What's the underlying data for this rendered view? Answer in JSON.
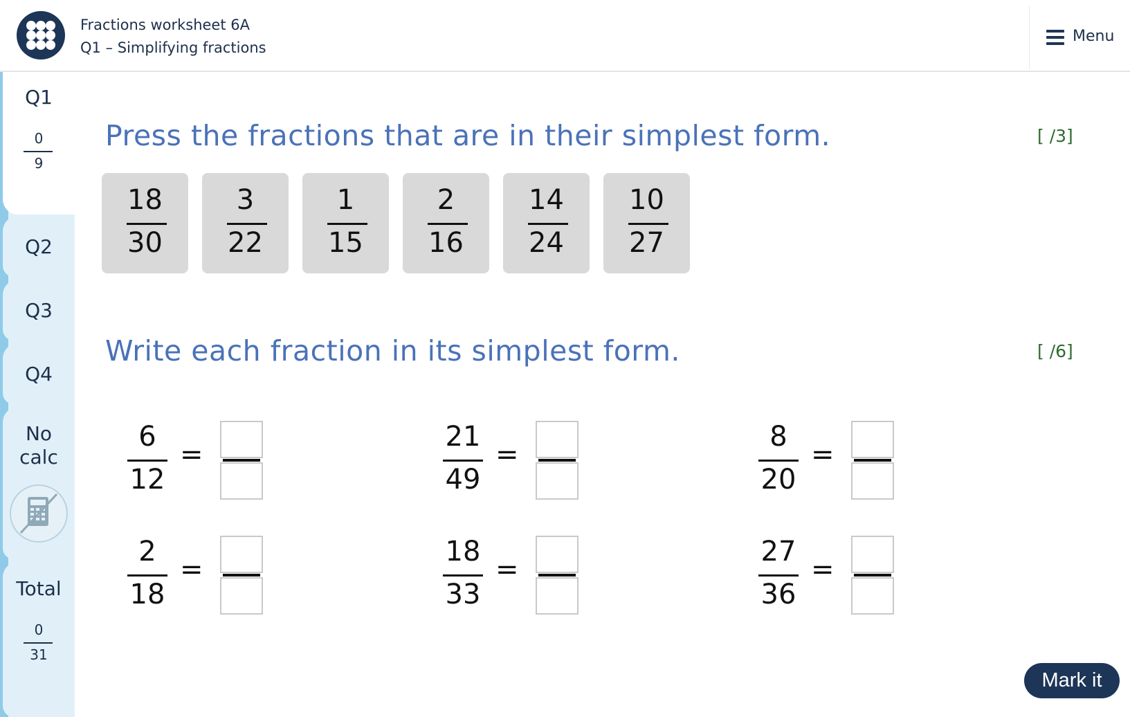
{
  "header": {
    "title": "Fractions worksheet 6A",
    "subtitle": "Q1 – Simplifying fractions",
    "logo_icon": "dots-grid-icon",
    "menu_label": "Menu"
  },
  "sidebar": {
    "q1": {
      "label": "Q1",
      "score": "0",
      "max": "9"
    },
    "q2": {
      "label": "Q2"
    },
    "q3": {
      "label": "Q3"
    },
    "q4": {
      "label": "Q4"
    },
    "nocalc": {
      "line1": "No",
      "line2": "calc",
      "icon": "no-calculator-icon"
    },
    "total": {
      "label": "Total",
      "score": "0",
      "max": "31"
    }
  },
  "part1": {
    "instruction": "Press the fractions that are in their simplest form.",
    "marks": "[ /3]",
    "cards": [
      {
        "num": "18",
        "den": "30"
      },
      {
        "num": "3",
        "den": "22"
      },
      {
        "num": "1",
        "den": "15"
      },
      {
        "num": "2",
        "den": "16"
      },
      {
        "num": "14",
        "den": "24"
      },
      {
        "num": "10",
        "den": "27"
      }
    ]
  },
  "part2": {
    "instruction": "Write each fraction in its simplest form.",
    "marks": "[ /6]",
    "equals": "=",
    "questions": [
      {
        "num": "6",
        "den": "12"
      },
      {
        "num": "21",
        "den": "49"
      },
      {
        "num": "8",
        "den": "20"
      },
      {
        "num": "2",
        "den": "18"
      },
      {
        "num": "18",
        "den": "33"
      },
      {
        "num": "27",
        "den": "36"
      }
    ]
  },
  "mark_button": "Mark it",
  "colors": {
    "navy": "#1d3557",
    "heading_blue": "#4a72b8",
    "marks_green": "#2f6b2f",
    "sidebar_bg": "#e1f0f8",
    "card_grey": "#d9d9d9"
  }
}
